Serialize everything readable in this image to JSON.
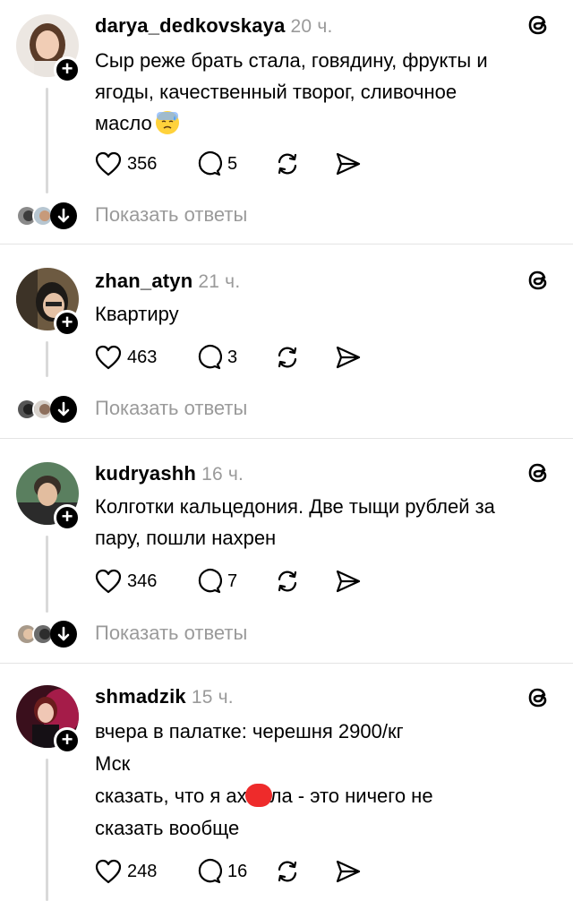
{
  "replies_label": "Показать ответы",
  "posts": [
    {
      "username": "darya_dedkovskaya",
      "time": "20 ч.",
      "lines": [
        "Сыр реже брать стала, говядину, фрукты и",
        "ягоды, качественный творог, сливочное",
        "масло"
      ],
      "emoji": "sad-sweat-emoji",
      "likes": "356",
      "comments": "5"
    },
    {
      "username": "zhan_atyn",
      "time": "21 ч.",
      "lines": [
        "Квартиру"
      ],
      "likes": "463",
      "comments": "3"
    },
    {
      "username": "kudryashh",
      "time": "16 ч.",
      "lines": [
        "Колготки кальцедония. Две тыщи рублей за",
        "пару, пошли нахрен"
      ],
      "likes": "346",
      "comments": "7"
    },
    {
      "username": "shmadzik",
      "time": "15 ч.",
      "lines": [
        "вчера в палатке: черешня 2900/кг",
        "Мск",
        "сказать, что я ах",
        "ла - это ничего не",
        "сказать вообще"
      ],
      "likes": "248",
      "comments": "16"
    }
  ]
}
